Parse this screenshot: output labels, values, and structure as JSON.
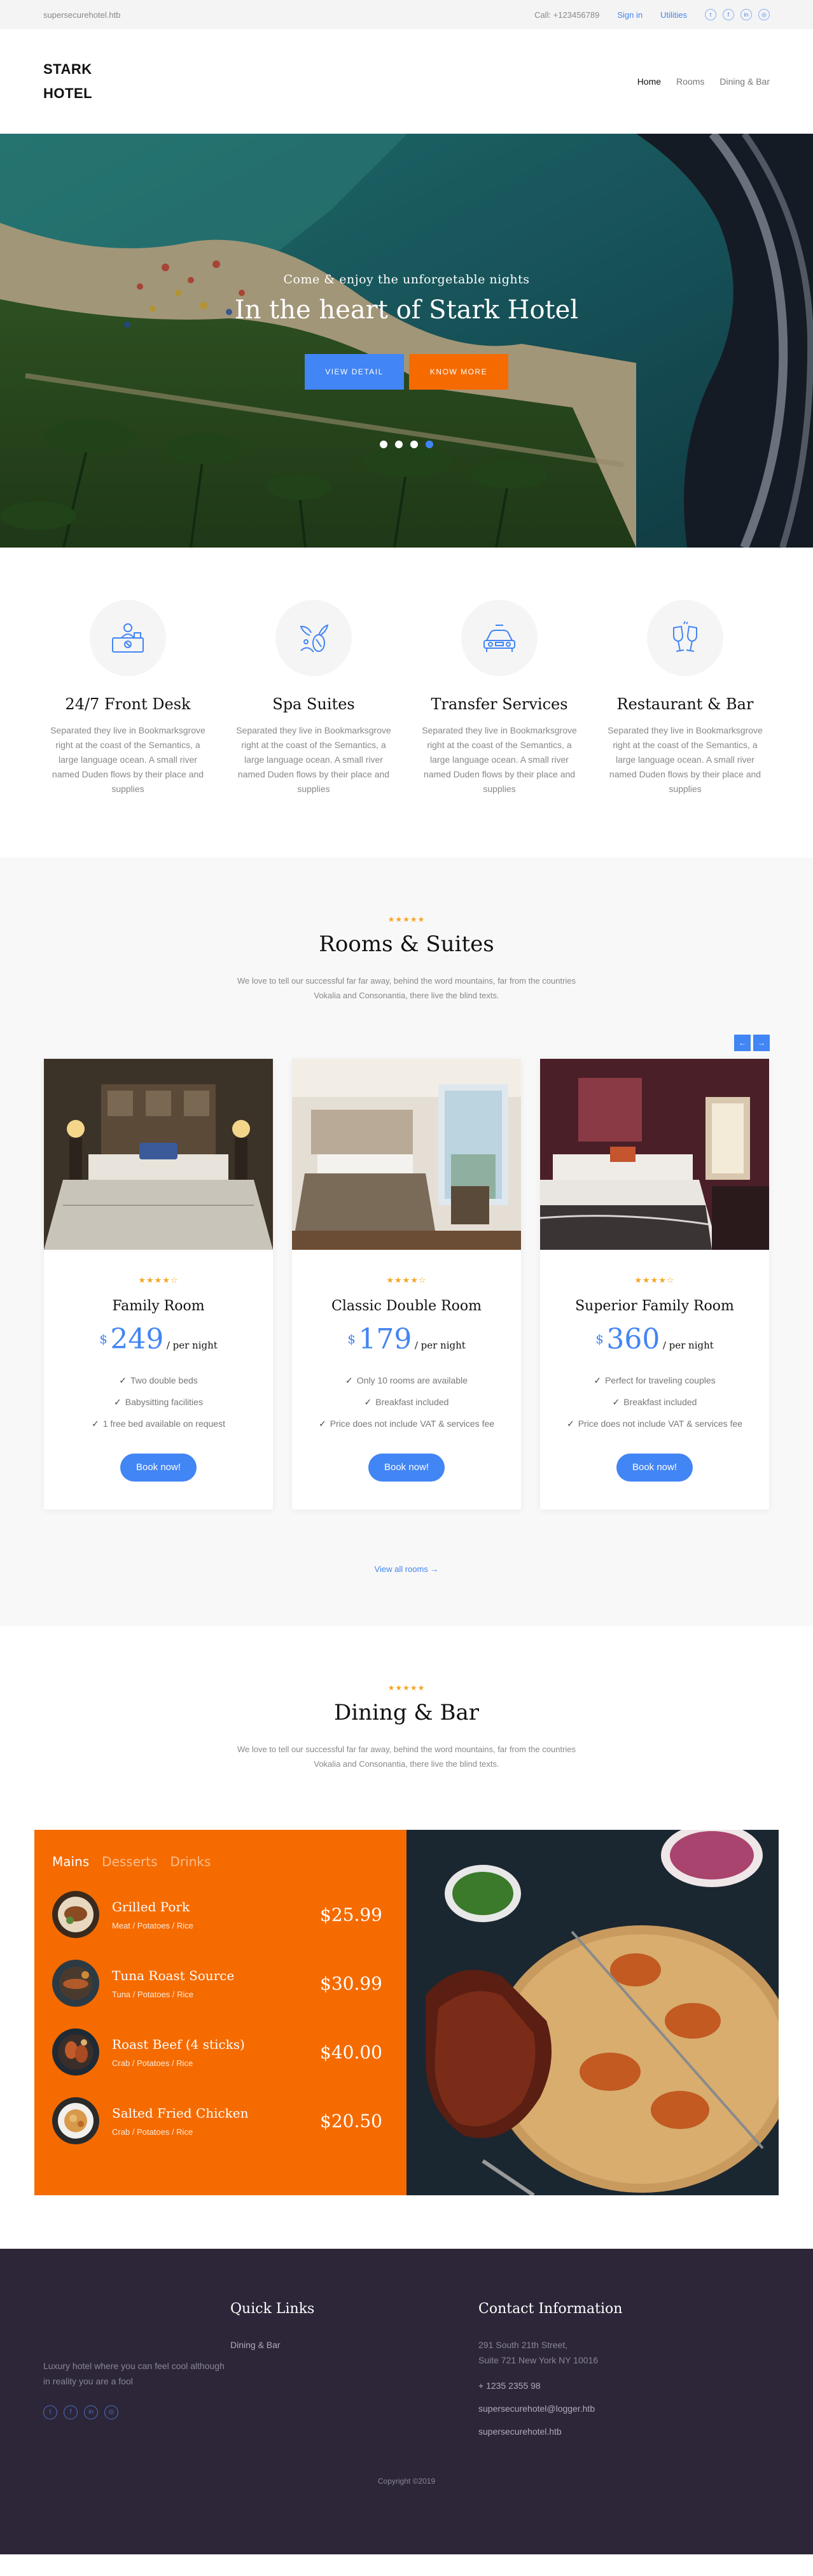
{
  "topbar": {
    "site": "supersecurehotel.htb",
    "call": "Call: +123456789",
    "signin": "Sign in",
    "utilities": "Utilities",
    "social": [
      "twitter-icon",
      "facebook-icon",
      "linkedin-icon",
      "instagram-icon"
    ]
  },
  "header": {
    "logo": "STARK HOTEL",
    "nav": [
      "Home",
      "Rooms",
      "Dining & Bar"
    ]
  },
  "hero": {
    "subtitle": "Come & enjoy the unforgetable nights",
    "title": "In the heart of Stark Hotel",
    "btn_primary": "VIEW DETAIL",
    "btn_secondary": "KNOW MORE",
    "active_slide": 4,
    "slides": 4
  },
  "services": [
    {
      "icon": "front-desk-icon",
      "title": "24/7 Front Desk",
      "text": "Separated they live in Bookmarksgrove right at the coast of the Semantics, a large language ocean. A small river named Duden flows by their place and supplies"
    },
    {
      "icon": "spa-icon",
      "title": "Spa Suites",
      "text": "Separated they live in Bookmarksgrove right at the coast of the Semantics, a large language ocean. A small river named Duden flows by their place and supplies"
    },
    {
      "icon": "car-icon",
      "title": "Transfer Services",
      "text": "Separated they live in Bookmarksgrove right at the coast of the Semantics, a large language ocean. A small river named Duden flows by their place and supplies"
    },
    {
      "icon": "wine-glasses-icon",
      "title": "Restaurant & Bar",
      "text": "Separated they live in Bookmarksgrove right at the coast of the Semantics, a large language ocean. A small river named Duden flows by their place and supplies"
    }
  ],
  "rooms": {
    "stars": "★★★★★",
    "title": "Rooms & Suites",
    "desc": "We love to tell our successful far far away, behind the word mountains, far from the countries Vokalia and Consonantia, there live the blind texts.",
    "prev": "←",
    "next": "→",
    "cards": [
      {
        "stars": "★★★★☆",
        "name": "Family Room",
        "currency": "$",
        "price": "249",
        "per": "/ per night",
        "features": [
          "Two double beds",
          "Babysitting facilities",
          "1 free bed available on request"
        ],
        "cta": "Book now!"
      },
      {
        "stars": "★★★★☆",
        "name": "Classic Double Room",
        "currency": "$",
        "price": "179",
        "per": "/ per night",
        "features": [
          "Only 10 rooms are available",
          "Breakfast included",
          "Price does not include VAT & services fee"
        ],
        "cta": "Book now!"
      },
      {
        "stars": "★★★★☆",
        "name": "Superior Family Room",
        "currency": "$",
        "price": "360",
        "per": "/ per night",
        "features": [
          "Perfect for traveling couples",
          "Breakfast included",
          "Price does not include VAT & services fee"
        ],
        "cta": "Book now!"
      }
    ],
    "view_all": "View all rooms →"
  },
  "dining": {
    "stars": "★★★★★",
    "title": "Dining & Bar",
    "desc": "We love to tell our successful far far away, behind the word mountains, far from the countries Vokalia and Consonantia, there live the blind texts.",
    "tabs": [
      "Mains",
      "Desserts",
      "Drinks"
    ],
    "items": [
      {
        "name": "Grilled Pork",
        "ingredients": "Meat / Potatoes / Rice",
        "price": "$25.99"
      },
      {
        "name": "Tuna Roast Source",
        "ingredients": "Tuna / Potatoes / Rice",
        "price": "$30.99"
      },
      {
        "name": "Roast Beef (4 sticks)",
        "ingredients": "Crab / Potatoes / Rice",
        "price": "$40.00"
      },
      {
        "name": "Salted Fried Chicken",
        "ingredients": "Crab / Potatoes / Rice",
        "price": "$20.50"
      }
    ]
  },
  "footer": {
    "about": "Luxury hotel where you can feel cool although in reality you are a fool",
    "quick_links_title": "Quick Links",
    "quick_links": [
      "Dining & Bar"
    ],
    "contact_title": "Contact Information",
    "address_line1": "291 South 21th Street,",
    "address_line2": "Suite 721 New York NY 10016",
    "phone": "+ 1235 2355 98",
    "email": "supersecurehotel@logger.htb",
    "website": "supersecurehotel.htb",
    "copyright": "Copyright ©2019"
  },
  "colors": {
    "accent": "#4285f4",
    "orange": "#f56b00",
    "footer": "#2c2638"
  }
}
